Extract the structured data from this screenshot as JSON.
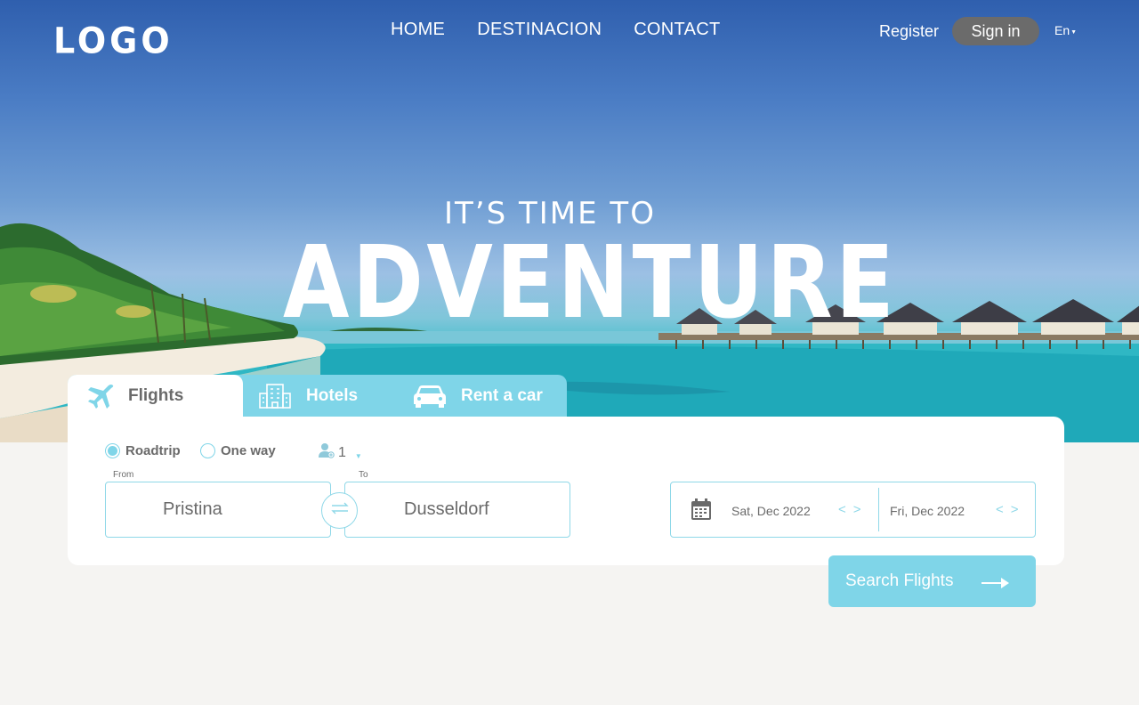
{
  "header": {
    "logo": "LOGO",
    "nav": [
      "HOME",
      "DESTINACION",
      "CONTACT"
    ],
    "register": "Register",
    "signin": "Sign in",
    "language": "En"
  },
  "hero": {
    "tagline": "IT’S TIME TO",
    "headline": "ADVENTURE"
  },
  "tabs": [
    {
      "label": "Flights",
      "icon": "airplane-icon",
      "active": true
    },
    {
      "label": "Hotels",
      "icon": "hotel-icon",
      "active": false
    },
    {
      "label": "Rent a car",
      "icon": "car-icon",
      "active": false
    }
  ],
  "search": {
    "trip_types": [
      {
        "label": "Roadtrip",
        "selected": true
      },
      {
        "label": "One way",
        "selected": false
      }
    ],
    "passengers": "1",
    "from_label": "From",
    "from_value": "Pristina",
    "to_label": "To",
    "to_value": "Dusseldorf",
    "depart_date": "Sat, Dec 2022",
    "return_date": "Fri, Dec 2022",
    "prev": "<",
    "next": ">",
    "button": "Search Flights"
  },
  "colors": {
    "accent": "#7fd5e8",
    "text": "#6a6a6a",
    "signin_bg": "#6b6b6b",
    "page_bg": "#f5f4f2"
  }
}
